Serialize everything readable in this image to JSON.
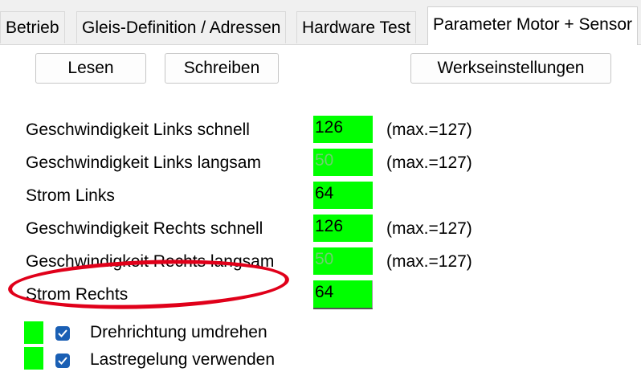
{
  "tabs": [
    {
      "label": "Betrieb",
      "active": false
    },
    {
      "label": "Gleis-Definition / Adressen",
      "active": false
    },
    {
      "label": "Hardware Test",
      "active": false
    },
    {
      "label": "Parameter Motor + Sensor",
      "active": true
    }
  ],
  "buttons": {
    "read": "Lesen",
    "write": "Schreiben",
    "factory": "Werkseinstellungen"
  },
  "params": [
    {
      "label": "Geschwindigkeit Links schnell",
      "value": "126",
      "max": "(max.=127)"
    },
    {
      "label": "Geschwindigkeit Links langsam",
      "value": "50",
      "max": "(max.=127)"
    },
    {
      "label": "Strom Links",
      "value": "64",
      "max": ""
    },
    {
      "label": "Geschwindigkeit Rechts schnell",
      "value": "126",
      "max": "(max.=127)"
    },
    {
      "label": "Geschwindigkeit Rechts langsam",
      "value": "50",
      "max": "(max.=127)"
    },
    {
      "label": "Strom Rechts",
      "value": "64",
      "max": ""
    }
  ],
  "checkboxes": [
    {
      "label": "Drehrichtung umdrehen",
      "checked": true
    },
    {
      "label": "Lastregelung verwenden",
      "checked": true
    }
  ],
  "colors": {
    "field_bg": "#00ff00",
    "highlight_ellipse": "#e0001a",
    "checkbox": "#1a5fb4"
  }
}
